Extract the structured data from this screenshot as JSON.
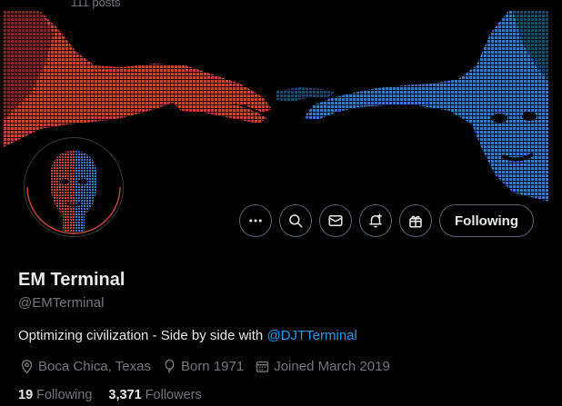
{
  "header": {
    "posts_count": "111 posts"
  },
  "profile": {
    "name": "EM Terminal",
    "handle": "@EMTerminal",
    "bio_text": "Optimizing civilization - Side by side with ",
    "bio_mention": "@DJTTerminal",
    "location": "Boca Chica, Texas",
    "born": "Born 1971",
    "joined": "Joined March 2019",
    "following_count": "19",
    "following_label": "Following",
    "followers_count": "3,371",
    "followers_label": "Followers"
  },
  "actions": {
    "follow_label": "Following",
    "icons": [
      "more-icon",
      "search-icon",
      "message-icon",
      "notification-icon",
      "gift-icon"
    ]
  },
  "colors": {
    "red_art": "#c0463e",
    "blue_art": "#3f79c0",
    "link": "#1d9bf0",
    "muted": "#71767b",
    "border": "#536471"
  }
}
